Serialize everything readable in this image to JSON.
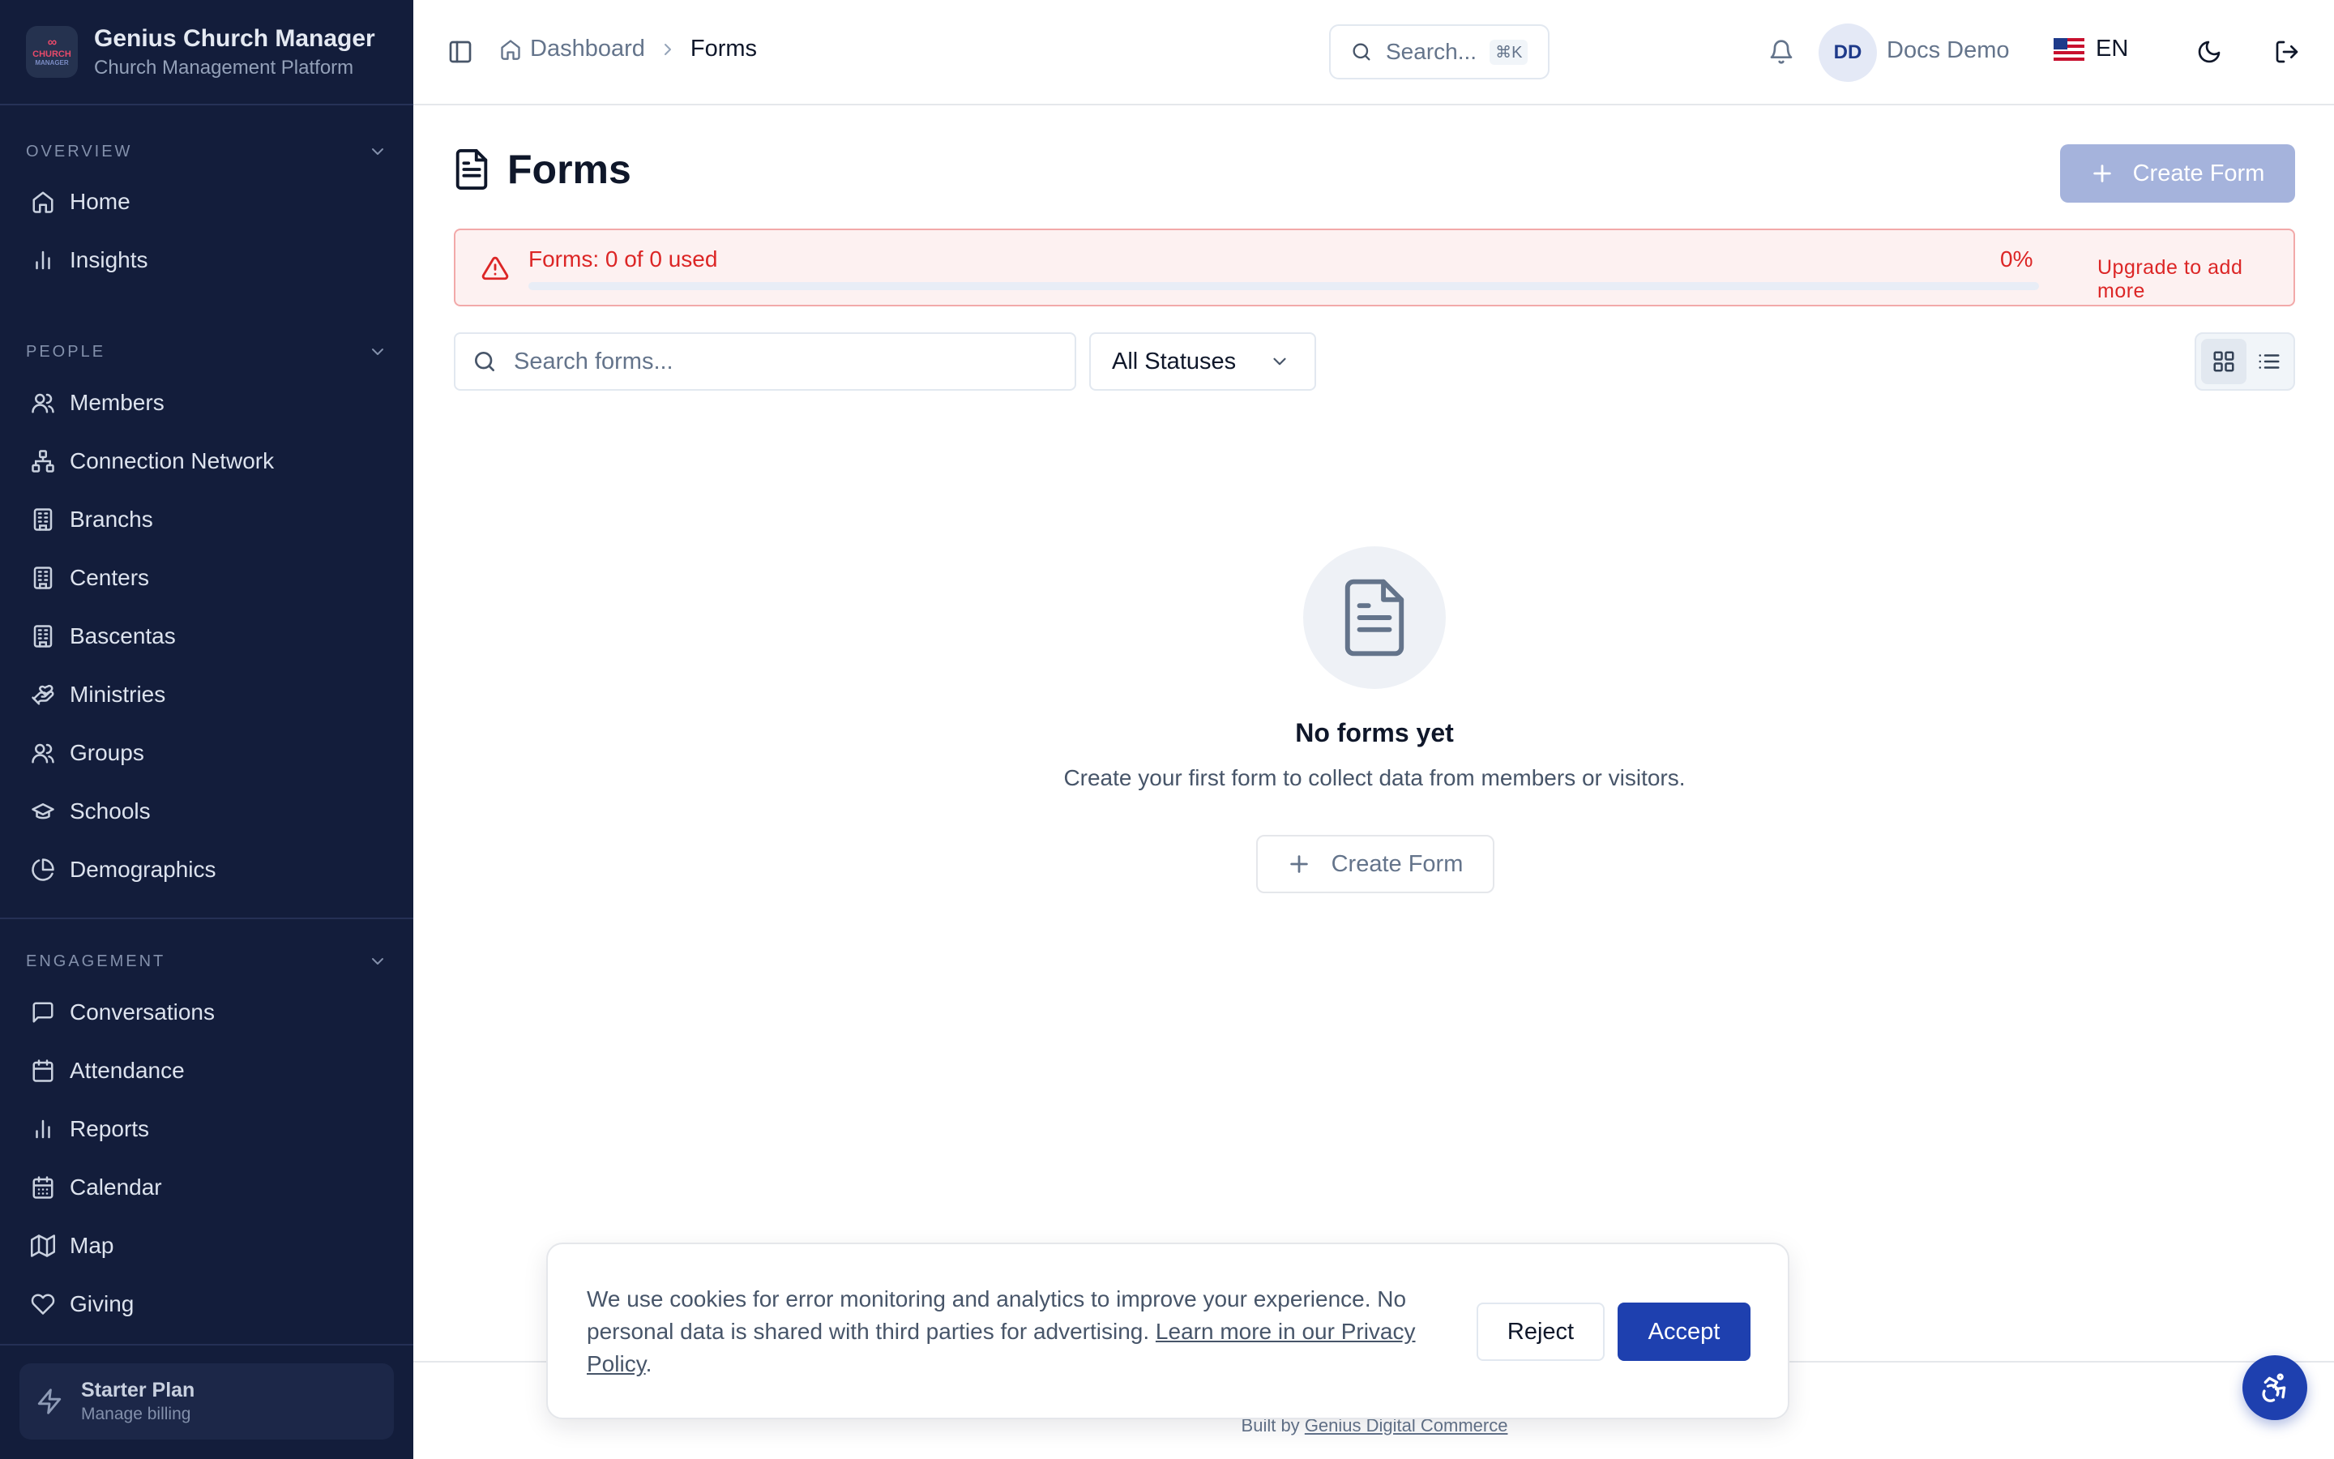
{
  "app": {
    "name": "Genius Church Manager",
    "subtitle": "Church Management Platform",
    "logo_mark": "∞",
    "logo_line1": "CHURCH",
    "logo_line2": "MANAGER"
  },
  "sidebar": {
    "sections": [
      {
        "title": "OVERVIEW",
        "items": [
          {
            "label": "Home",
            "icon": "home-icon"
          },
          {
            "label": "Insights",
            "icon": "bar-chart-icon"
          }
        ]
      },
      {
        "title": "PEOPLE",
        "items": [
          {
            "label": "Members",
            "icon": "users-icon"
          },
          {
            "label": "Connection Network",
            "icon": "network-icon"
          },
          {
            "label": "Branchs",
            "icon": "building-icon"
          },
          {
            "label": "Centers",
            "icon": "building-icon"
          },
          {
            "label": "Bascentas",
            "icon": "building-icon"
          },
          {
            "label": "Ministries",
            "icon": "hand-heart-icon"
          },
          {
            "label": "Groups",
            "icon": "users-icon"
          },
          {
            "label": "Schools",
            "icon": "graduation-cap-icon"
          },
          {
            "label": "Demographics",
            "icon": "pie-chart-icon"
          }
        ]
      },
      {
        "title": "ENGAGEMENT",
        "items": [
          {
            "label": "Conversations",
            "icon": "message-icon"
          },
          {
            "label": "Attendance",
            "icon": "calendar-check-icon"
          },
          {
            "label": "Reports",
            "icon": "bar-chart-icon"
          },
          {
            "label": "Calendar",
            "icon": "calendar-icon"
          },
          {
            "label": "Map",
            "icon": "map-icon"
          },
          {
            "label": "Giving",
            "icon": "heart-icon"
          }
        ]
      }
    ],
    "plan": {
      "title": "Starter Plan",
      "subtitle": "Manage billing"
    }
  },
  "topbar": {
    "breadcrumb": {
      "home": "Dashboard",
      "current": "Forms"
    },
    "search_placeholder": "Search...",
    "search_shortcut": "⌘K",
    "user": {
      "initials": "DD",
      "name": "Docs Demo"
    },
    "language": "EN"
  },
  "page": {
    "title": "Forms",
    "create_button": "Create Form",
    "quota": {
      "label": "Forms: 0 of 0 used",
      "percent_label": "0%",
      "percent_value": 0,
      "upgrade_link": "Upgrade to add more"
    },
    "search_placeholder": "Search forms...",
    "status_filter": "All Statuses",
    "view_mode": "grid",
    "empty": {
      "title": "No forms yet",
      "description": "Create your first form to collect data from members or visitors.",
      "button": "Create Form"
    }
  },
  "footer": {
    "built_by": "Built by",
    "company": "Genius Digital Commerce"
  },
  "cookie_banner": {
    "text": "We use cookies for error monitoring and analytics to improve your experience. No personal data is shared with third parties for advertising. ",
    "link": "Learn more in our Privacy Policy",
    "after_link": ".",
    "reject": "Reject",
    "accept": "Accept"
  },
  "colors": {
    "sidebar_bg": "#131d3b",
    "primary": "#1e40af",
    "danger": "#dc2626",
    "create_button_disabled": "#a5b3dc"
  }
}
